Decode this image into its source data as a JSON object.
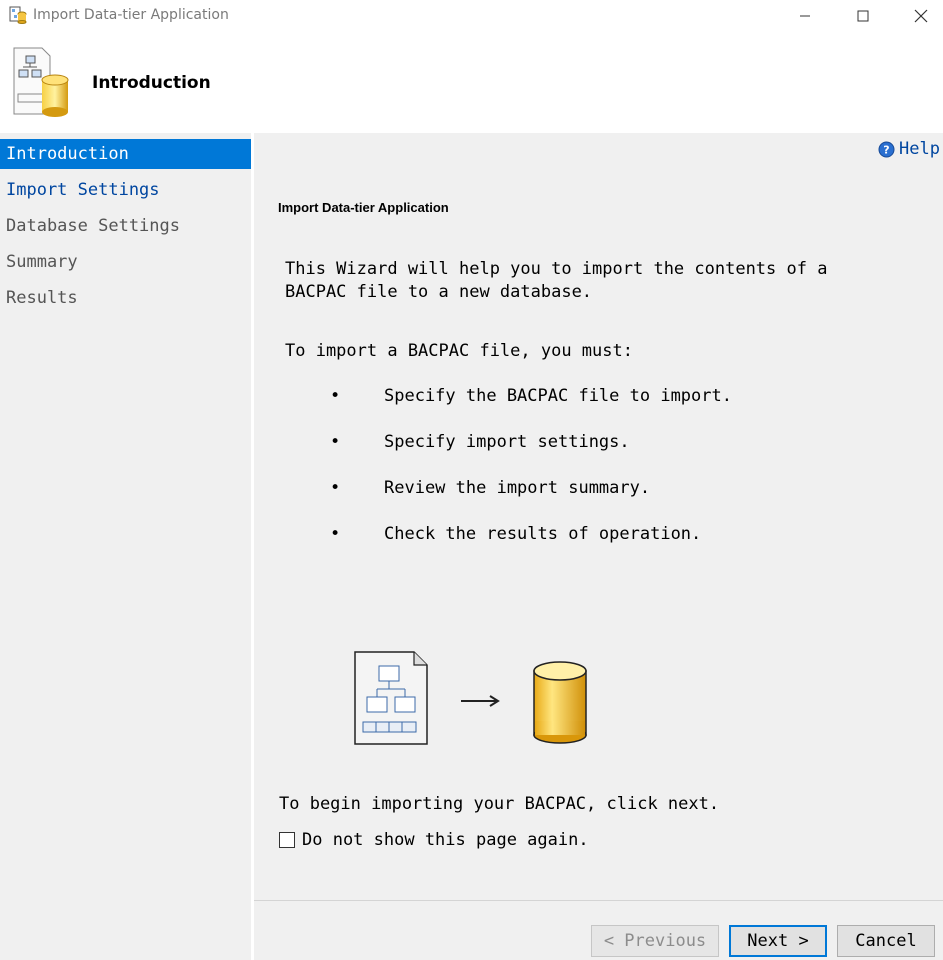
{
  "window": {
    "title": "Import Data-tier Application",
    "controls": [
      "minimize-icon",
      "maximize-icon",
      "close-icon"
    ]
  },
  "header": {
    "title": "Introduction"
  },
  "sidebar": {
    "items": [
      {
        "label": "Introduction",
        "state": "active"
      },
      {
        "label": "Import Settings",
        "state": "link"
      },
      {
        "label": "Database Settings",
        "state": "disabled"
      },
      {
        "label": "Summary",
        "state": "disabled"
      },
      {
        "label": "Results",
        "state": "disabled"
      }
    ]
  },
  "main": {
    "help_label": "Help",
    "section_title": "Import Data-tier Application",
    "intro_line1": "This Wizard will help you to import the contents of a",
    "intro_line2": "BACPAC file to a new database.",
    "requirements_heading": "To import a BACPAC file, you must:",
    "bullet_char": "•",
    "steps": [
      "Specify the BACPAC file to import.",
      "Specify import settings.",
      "Review the import summary.",
      "Check the results of operation."
    ],
    "begin_text": "To begin importing your BACPAC, click next.",
    "dont_show_label": "Do not show this page again.",
    "dont_show_checked": false
  },
  "footer": {
    "previous_label": "< Previous",
    "next_label": "Next >",
    "cancel_label": "Cancel"
  },
  "colors": {
    "accent": "#0078d7",
    "link": "#0046a0",
    "panel": "#f0f0f0"
  }
}
